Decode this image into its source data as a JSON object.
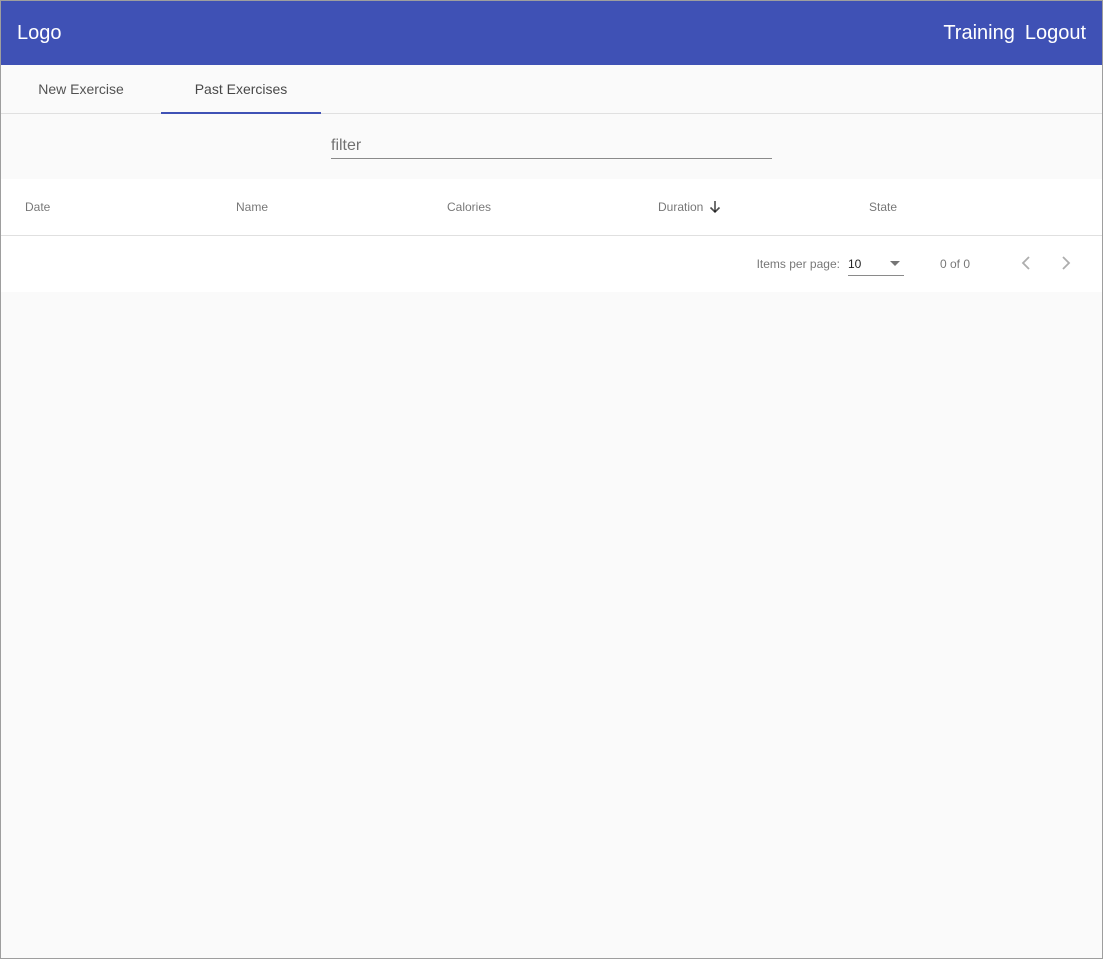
{
  "toolbar": {
    "logo": "Logo",
    "nav": {
      "training": "Training",
      "logout": "Logout"
    }
  },
  "tabs": [
    {
      "label": "New Exercise",
      "active": false
    },
    {
      "label": "Past Exercises",
      "active": true
    }
  ],
  "filter": {
    "placeholder": "filter",
    "value": ""
  },
  "table": {
    "columns": [
      "Date",
      "Name",
      "Calories",
      "Duration",
      "State"
    ],
    "sorted_column": "Duration",
    "sort_direction": "descending",
    "rows": []
  },
  "paginator": {
    "items_per_page_label": "Items per page:",
    "items_per_page_value": "10",
    "range_label": "0 of 0",
    "prev_icon": "chevron-left-icon",
    "next_icon": "chevron-right-icon"
  },
  "colors": {
    "primary": "#3f51b5",
    "background": "#fafafa"
  }
}
